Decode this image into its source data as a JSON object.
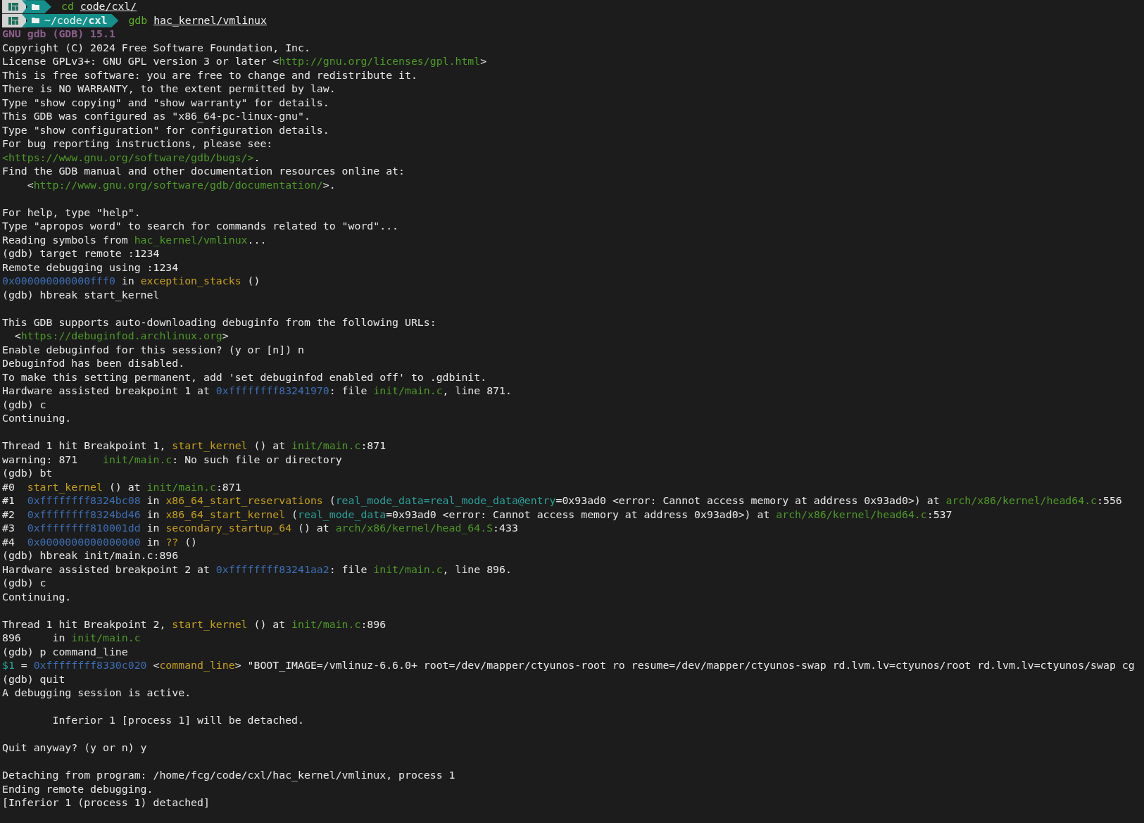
{
  "terminal": {
    "lines": [
      {
        "kind": "prompt",
        "command": "cd",
        "argument": "code/cxl/"
      },
      {
        "kind": "prompt",
        "path_dir": "~/code/",
        "path_leaf": "cxl",
        "command": "gdb",
        "argument": "hac_kernel/vmlinux"
      },
      {
        "kind": "output",
        "segments": [
          {
            "text": "GNU gdb (GDB) 15.1",
            "kind": "header"
          }
        ]
      },
      {
        "kind": "output",
        "segments": [
          {
            "text": "Copyright (C) 2024 Free Software Foundation, Inc.",
            "kind": "plain"
          }
        ]
      },
      {
        "kind": "output",
        "segments": [
          {
            "text": "License GPLv3+: GNU GPL version 3 or later <",
            "kind": "plain"
          },
          {
            "text": "http://gnu.org/licenses/gpl.html",
            "kind": "link"
          },
          {
            "text": ">",
            "kind": "plain"
          }
        ]
      },
      {
        "kind": "output",
        "segments": [
          {
            "text": "This is free software: you are free to change and redistribute it.",
            "kind": "plain"
          }
        ]
      },
      {
        "kind": "output",
        "segments": [
          {
            "text": "There is NO WARRANTY, to the extent permitted by law.",
            "kind": "plain"
          }
        ]
      },
      {
        "kind": "output",
        "segments": [
          {
            "text": "Type \"show copying\" and \"show warranty\" for details.",
            "kind": "plain"
          }
        ]
      },
      {
        "kind": "output",
        "segments": [
          {
            "text": "This GDB was configured as \"x86_64-pc-linux-gnu\".",
            "kind": "plain"
          }
        ]
      },
      {
        "kind": "output",
        "segments": [
          {
            "text": "Type \"show configuration\" for configuration details.",
            "kind": "plain"
          }
        ]
      },
      {
        "kind": "output",
        "segments": [
          {
            "text": "For bug reporting instructions, please see:",
            "kind": "plain"
          }
        ]
      },
      {
        "kind": "output",
        "segments": [
          {
            "text": "<https://www.gnu.org/software/gdb/bugs/>",
            "kind": "link"
          },
          {
            "text": ".",
            "kind": "plain"
          }
        ]
      },
      {
        "kind": "output",
        "segments": [
          {
            "text": "Find the GDB manual and other documentation resources online at:",
            "kind": "plain"
          }
        ]
      },
      {
        "kind": "output",
        "segments": [
          {
            "text": "    <",
            "kind": "plain"
          },
          {
            "text": "http://www.gnu.org/software/gdb/documentation/",
            "kind": "link"
          },
          {
            "text": ">.",
            "kind": "plain"
          }
        ]
      },
      {
        "kind": "blank"
      },
      {
        "kind": "output",
        "segments": [
          {
            "text": "For help, type \"help\".",
            "kind": "plain"
          }
        ]
      },
      {
        "kind": "output",
        "segments": [
          {
            "text": "Type \"apropos word\" to search for commands related to \"word\"...",
            "kind": "plain"
          }
        ]
      },
      {
        "kind": "output",
        "segments": [
          {
            "text": "Reading symbols from ",
            "kind": "plain"
          },
          {
            "text": "hac_kernel/vmlinux",
            "kind": "file"
          },
          {
            "text": "...",
            "kind": "plain"
          }
        ]
      },
      {
        "kind": "output",
        "segments": [
          {
            "text": "(gdb) target remote :1234",
            "kind": "plain"
          }
        ]
      },
      {
        "kind": "output",
        "segments": [
          {
            "text": "Remote debugging using :1234",
            "kind": "plain"
          }
        ]
      },
      {
        "kind": "output",
        "segments": [
          {
            "text": "0x000000000000fff0",
            "kind": "addr"
          },
          {
            "text": " in ",
            "kind": "plain"
          },
          {
            "text": "exception_stacks",
            "kind": "func"
          },
          {
            "text": " ()",
            "kind": "plain"
          }
        ]
      },
      {
        "kind": "output",
        "segments": [
          {
            "text": "(gdb) hbreak start_kernel",
            "kind": "plain"
          }
        ]
      },
      {
        "kind": "blank"
      },
      {
        "kind": "output",
        "segments": [
          {
            "text": "This GDB supports auto-downloading debuginfo from the following URLs:",
            "kind": "plain"
          }
        ]
      },
      {
        "kind": "output",
        "segments": [
          {
            "text": "  <",
            "kind": "plain"
          },
          {
            "text": "https://debuginfod.archlinux.org",
            "kind": "link"
          },
          {
            "text": ">",
            "kind": "plain"
          }
        ]
      },
      {
        "kind": "output",
        "segments": [
          {
            "text": "Enable debuginfod for this session? (y or [n]) n",
            "kind": "plain"
          }
        ]
      },
      {
        "kind": "output",
        "segments": [
          {
            "text": "Debuginfod has been disabled.",
            "kind": "plain"
          }
        ]
      },
      {
        "kind": "output",
        "segments": [
          {
            "text": "To make this setting permanent, add 'set debuginfod enabled off' to .gdbinit.",
            "kind": "plain"
          }
        ]
      },
      {
        "kind": "output",
        "segments": [
          {
            "text": "Hardware assisted breakpoint 1 at ",
            "kind": "plain"
          },
          {
            "text": "0xffffffff83241970",
            "kind": "addr"
          },
          {
            "text": ": file ",
            "kind": "plain"
          },
          {
            "text": "init/main.c",
            "kind": "file"
          },
          {
            "text": ", line 871.",
            "kind": "plain"
          }
        ]
      },
      {
        "kind": "output",
        "segments": [
          {
            "text": "(gdb) c",
            "kind": "plain"
          }
        ]
      },
      {
        "kind": "output",
        "segments": [
          {
            "text": "Continuing.",
            "kind": "plain"
          }
        ]
      },
      {
        "kind": "blank"
      },
      {
        "kind": "output",
        "segments": [
          {
            "text": "Thread 1 hit Breakpoint 1, ",
            "kind": "plain"
          },
          {
            "text": "start_kernel",
            "kind": "func"
          },
          {
            "text": " () at ",
            "kind": "plain"
          },
          {
            "text": "init/main.c",
            "kind": "file"
          },
          {
            "text": ":871",
            "kind": "plain"
          }
        ]
      },
      {
        "kind": "output",
        "segments": [
          {
            "text": "warning: 871    ",
            "kind": "plain"
          },
          {
            "text": "init/main.c",
            "kind": "file"
          },
          {
            "text": ": No such file or directory",
            "kind": "plain"
          }
        ]
      },
      {
        "kind": "output",
        "segments": [
          {
            "text": "(gdb) bt",
            "kind": "plain"
          }
        ]
      },
      {
        "kind": "output",
        "segments": [
          {
            "text": "#0  ",
            "kind": "plain"
          },
          {
            "text": "start_kernel",
            "kind": "func"
          },
          {
            "text": " () at ",
            "kind": "plain"
          },
          {
            "text": "init/main.c",
            "kind": "file"
          },
          {
            "text": ":871",
            "kind": "plain"
          }
        ]
      },
      {
        "kind": "output",
        "segments": [
          {
            "text": "#1  ",
            "kind": "plain"
          },
          {
            "text": "0xffffffff8324bc08",
            "kind": "addr"
          },
          {
            "text": " in ",
            "kind": "plain"
          },
          {
            "text": "x86_64_start_reservations",
            "kind": "func"
          },
          {
            "text": " (",
            "kind": "plain"
          },
          {
            "text": "real_mode_data=real_mode_data@entry",
            "kind": "var"
          },
          {
            "text": "=0x93ad0 <error: Cannot access memory at address 0x93ad0>) at ",
            "kind": "plain"
          },
          {
            "text": "arch/x86/kernel/head64.c",
            "kind": "file"
          },
          {
            "text": ":556",
            "kind": "plain"
          }
        ]
      },
      {
        "kind": "output",
        "segments": [
          {
            "text": "#2  ",
            "kind": "plain"
          },
          {
            "text": "0xffffffff8324bd46",
            "kind": "addr"
          },
          {
            "text": " in ",
            "kind": "plain"
          },
          {
            "text": "x86_64_start_kernel",
            "kind": "func"
          },
          {
            "text": " (",
            "kind": "plain"
          },
          {
            "text": "real_mode_data",
            "kind": "var"
          },
          {
            "text": "=0x93ad0 <error: Cannot access memory at address 0x93ad0>) at ",
            "kind": "plain"
          },
          {
            "text": "arch/x86/kernel/head64.c",
            "kind": "file"
          },
          {
            "text": ":537",
            "kind": "plain"
          }
        ]
      },
      {
        "kind": "output",
        "segments": [
          {
            "text": "#3  ",
            "kind": "plain"
          },
          {
            "text": "0xffffffff810001dd",
            "kind": "addr"
          },
          {
            "text": " in ",
            "kind": "plain"
          },
          {
            "text": "secondary_startup_64",
            "kind": "func"
          },
          {
            "text": " () at ",
            "kind": "plain"
          },
          {
            "text": "arch/x86/kernel/head_64.S",
            "kind": "file"
          },
          {
            "text": ":433",
            "kind": "plain"
          }
        ]
      },
      {
        "kind": "output",
        "segments": [
          {
            "text": "#4  ",
            "kind": "plain"
          },
          {
            "text": "0x0000000000000000",
            "kind": "addr"
          },
          {
            "text": " in ",
            "kind": "plain"
          },
          {
            "text": "??",
            "kind": "func"
          },
          {
            "text": " ()",
            "kind": "plain"
          }
        ]
      },
      {
        "kind": "output",
        "segments": [
          {
            "text": "(gdb) hbreak init/main.c:896",
            "kind": "plain"
          }
        ]
      },
      {
        "kind": "output",
        "segments": [
          {
            "text": "Hardware assisted breakpoint 2 at ",
            "kind": "plain"
          },
          {
            "text": "0xffffffff83241aa2",
            "kind": "addr"
          },
          {
            "text": ": file ",
            "kind": "plain"
          },
          {
            "text": "init/main.c",
            "kind": "file"
          },
          {
            "text": ", line 896.",
            "kind": "plain"
          }
        ]
      },
      {
        "kind": "output",
        "segments": [
          {
            "text": "(gdb) c",
            "kind": "plain"
          }
        ]
      },
      {
        "kind": "output",
        "segments": [
          {
            "text": "Continuing.",
            "kind": "plain"
          }
        ]
      },
      {
        "kind": "blank"
      },
      {
        "kind": "output",
        "segments": [
          {
            "text": "Thread 1 hit Breakpoint 2, ",
            "kind": "plain"
          },
          {
            "text": "start_kernel",
            "kind": "func"
          },
          {
            "text": " () at ",
            "kind": "plain"
          },
          {
            "text": "init/main.c",
            "kind": "file"
          },
          {
            "text": ":896",
            "kind": "plain"
          }
        ]
      },
      {
        "kind": "output",
        "segments": [
          {
            "text": "896     in ",
            "kind": "plain"
          },
          {
            "text": "init/main.c",
            "kind": "file"
          }
        ]
      },
      {
        "kind": "output",
        "segments": [
          {
            "text": "(gdb) p command_line",
            "kind": "plain"
          }
        ]
      },
      {
        "kind": "output",
        "segments": [
          {
            "text": "$1",
            "kind": "var"
          },
          {
            "text": " = ",
            "kind": "plain"
          },
          {
            "text": "0xffffffff8330c020",
            "kind": "addr"
          },
          {
            "text": " <",
            "kind": "plain"
          },
          {
            "text": "command_line",
            "kind": "func"
          },
          {
            "text": "> \"BOOT_IMAGE=/vmlinuz-6.6.0+ root=/dev/mapper/ctyunos-root ro resume=/dev/mapper/ctyunos-swap rd.lvm.lv=ctyunos/root rd.lvm.lv=ctyunos/swap cg",
            "kind": "plain"
          }
        ]
      },
      {
        "kind": "output",
        "segments": [
          {
            "text": "(gdb) quit",
            "kind": "plain"
          }
        ]
      },
      {
        "kind": "output",
        "segments": [
          {
            "text": "A debugging session is active.",
            "kind": "plain"
          }
        ]
      },
      {
        "kind": "blank"
      },
      {
        "kind": "output",
        "segments": [
          {
            "text": "        Inferior 1 [process 1] will be detached.",
            "kind": "plain"
          }
        ]
      },
      {
        "kind": "blank"
      },
      {
        "kind": "output",
        "segments": [
          {
            "text": "Quit anyway? (y or n) y",
            "kind": "plain"
          }
        ]
      },
      {
        "kind": "blank"
      },
      {
        "kind": "output",
        "segments": [
          {
            "text": "Detaching from program: /home/fcg/code/cxl/hac_kernel/vmlinux, process 1",
            "kind": "plain"
          }
        ]
      },
      {
        "kind": "output",
        "segments": [
          {
            "text": "Ending remote debugging.",
            "kind": "plain"
          }
        ]
      },
      {
        "kind": "output",
        "segments": [
          {
            "text": "[Inferior 1 (process 1) detached]",
            "kind": "plain"
          }
        ]
      }
    ]
  }
}
